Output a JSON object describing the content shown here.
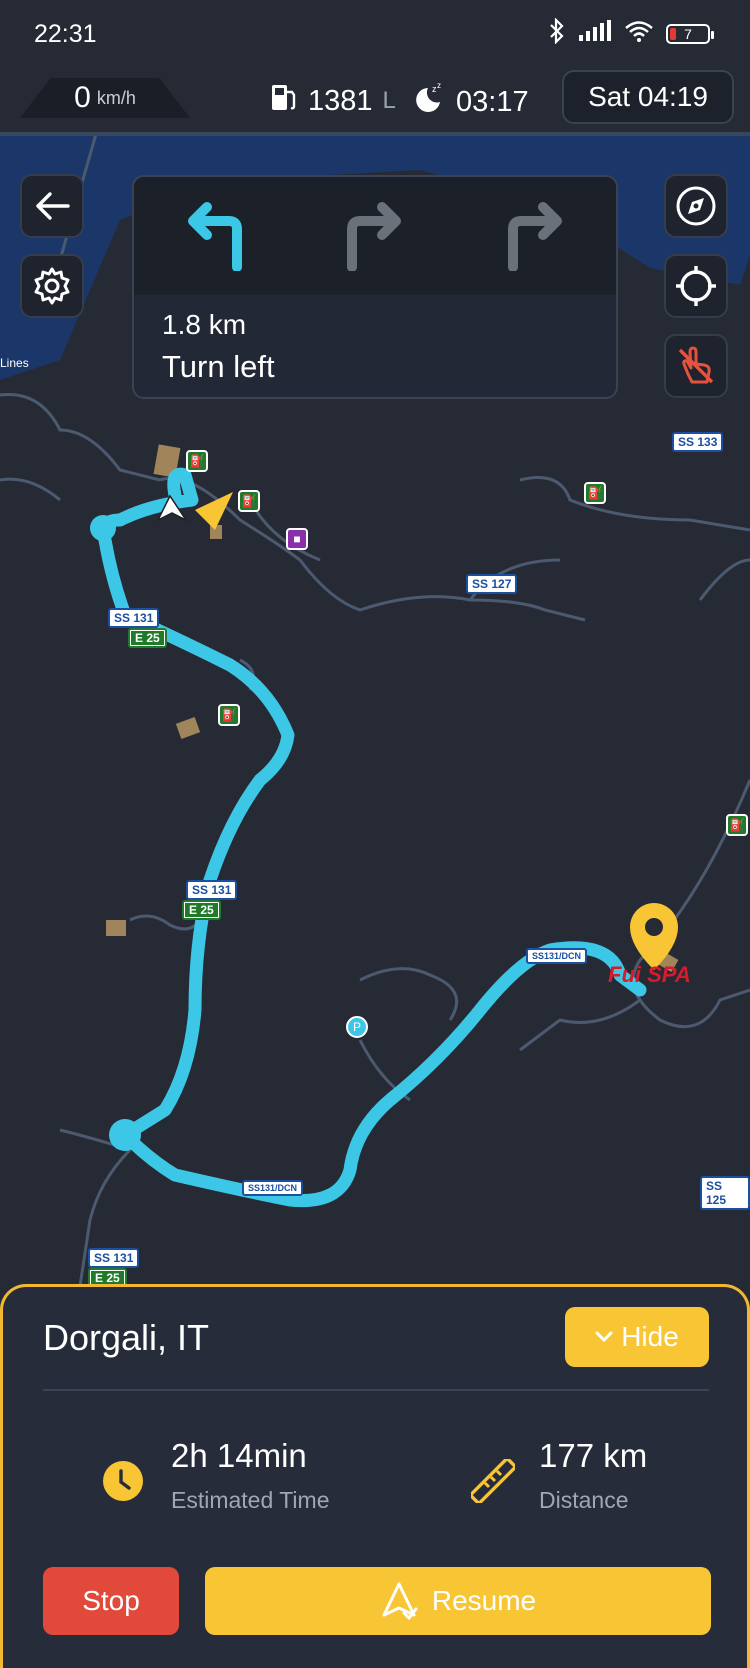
{
  "status_bar": {
    "time": "22:31",
    "battery": "7"
  },
  "info_bar": {
    "speed": "0",
    "speed_unit": "km/h",
    "fuel": "1381",
    "fuel_unit": "L",
    "rest_time": "03:17",
    "clock": "Sat 04:19"
  },
  "navigation": {
    "distance": "1.8 km",
    "instruction": "Turn left"
  },
  "map": {
    "shields": [
      {
        "id": "ss133",
        "text": "SS 133"
      },
      {
        "id": "ss127",
        "text": "SS 127"
      },
      {
        "id": "ss131a",
        "text": "SS 131"
      },
      {
        "id": "e25a",
        "text": "E 25"
      },
      {
        "id": "ss131b",
        "text": "SS 131"
      },
      {
        "id": "e25b",
        "text": "E 25"
      },
      {
        "id": "ss131dcn1",
        "text": "SS131/DCN"
      },
      {
        "id": "ss131dcn2",
        "text": "SS131/DCN"
      },
      {
        "id": "ss125",
        "text": "SS 125"
      },
      {
        "id": "ss131c",
        "text": "SS 131"
      },
      {
        "id": "e25c",
        "text": "E 25"
      }
    ],
    "labels": {
      "left_edge": "Lines",
      "brand_logo": "Fui SPA"
    },
    "route_color": "#3dc7e6",
    "accent_color": "#f8c534"
  },
  "destination": {
    "name": "Dorgali, IT",
    "hide_label": "Hide",
    "time_value": "2h 14min",
    "time_label": "Estimated Time",
    "distance_value": "177 km",
    "distance_label": "Distance",
    "stop_label": "Stop",
    "resume_label": "Resume"
  }
}
